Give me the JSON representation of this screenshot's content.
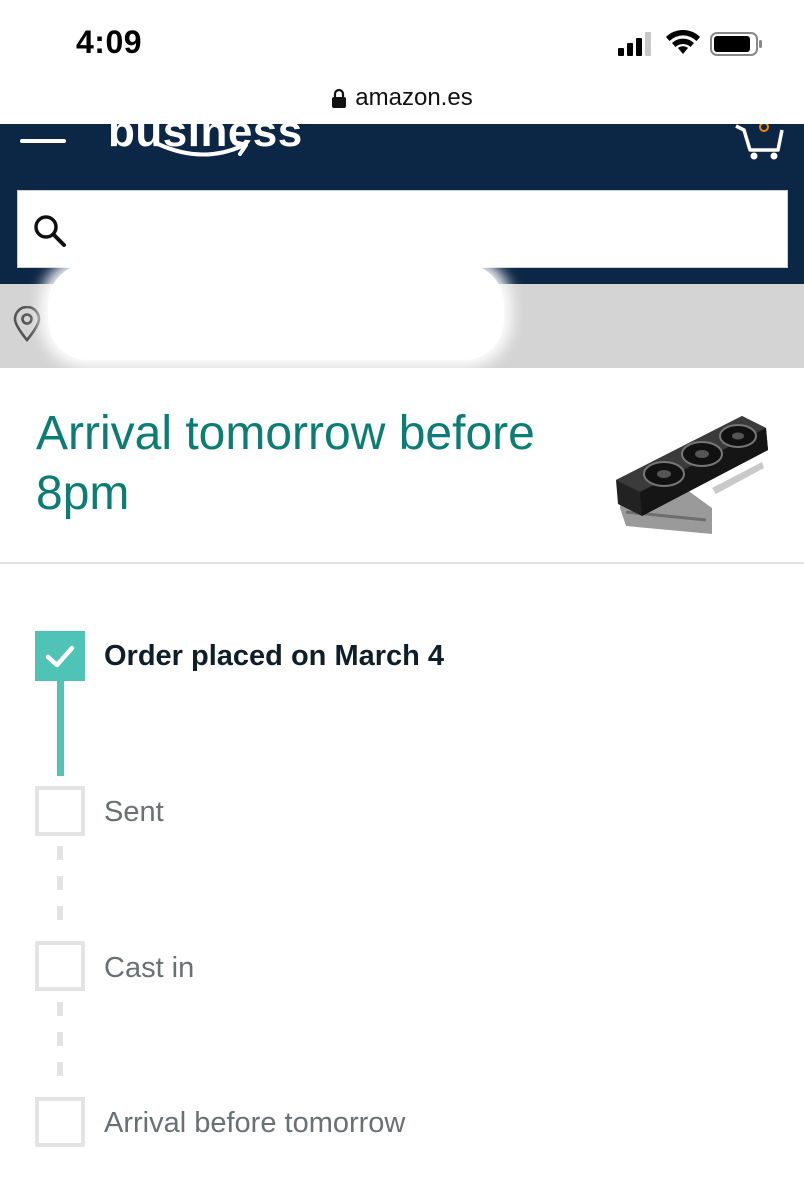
{
  "status_bar": {
    "time": "4:09"
  },
  "browser": {
    "url": "amazon.es"
  },
  "header": {
    "logo_text": "business",
    "search": {
      "value": "",
      "placeholder": ""
    }
  },
  "location": {
    "text": ""
  },
  "delivery": {
    "headline": "Arrival tomorrow before 8pm",
    "product_image_alt": "graphics card"
  },
  "tracker": {
    "steps": [
      {
        "label": "Order placed on March 4",
        "status": "done"
      },
      {
        "label": "Sent",
        "status": "pending"
      },
      {
        "label": "Cast in",
        "status": "pending"
      },
      {
        "label": "Arrival before tomorrow",
        "status": "pending"
      }
    ]
  },
  "colors": {
    "header_bg": "#0c2646",
    "accent_teal": "#4fc3b5",
    "headline_teal": "#0b7d75",
    "location_bg": "#d4d4d4"
  },
  "icons": [
    "signal-icon",
    "wifi-icon",
    "battery-icon",
    "lock-icon",
    "menu-icon",
    "cart-icon",
    "search-icon",
    "location-pin-icon",
    "check-icon"
  ]
}
